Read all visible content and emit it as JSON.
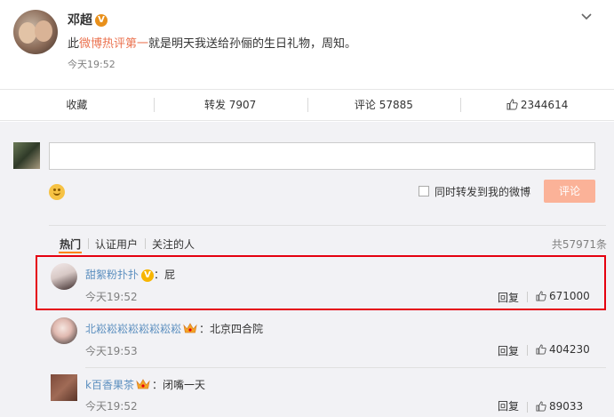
{
  "post": {
    "author": "邓超",
    "text_before": "此",
    "text_highlight": "微博热评第一",
    "text_after": "就是明天我送给孙俪的生日礼物，周知。",
    "time": "今天19:52"
  },
  "actions": {
    "favorite": "收藏",
    "repost": "转发 7907",
    "comment": "评论 57885",
    "like": "2344614"
  },
  "composer": {
    "input_value": "",
    "repost_label": "同时转发到我的微博",
    "submit_label": "评论"
  },
  "tabs": [
    "热门",
    "认证用户",
    "关注的人"
  ],
  "total": "共57971条",
  "comments": [
    {
      "name": "甜絮粉扑扑",
      "text": "：屁",
      "time": "今天19:52",
      "reply": "回复",
      "likes": "671000"
    },
    {
      "name": "北崧崧崧崧崧崧崧崧",
      "text": "：北京四合院",
      "time": "今天19:53",
      "reply": "回复",
      "likes": "404230"
    },
    {
      "name": "k百香果茶",
      "text": "：闭嘴一天",
      "time": "今天19:52",
      "reply": "回复",
      "likes": "89033"
    }
  ],
  "colors": {
    "accent": "#eb7350",
    "link": "#5c8fbf",
    "highlight_box": "#e5000f",
    "submit_bg": "#fbb298"
  }
}
